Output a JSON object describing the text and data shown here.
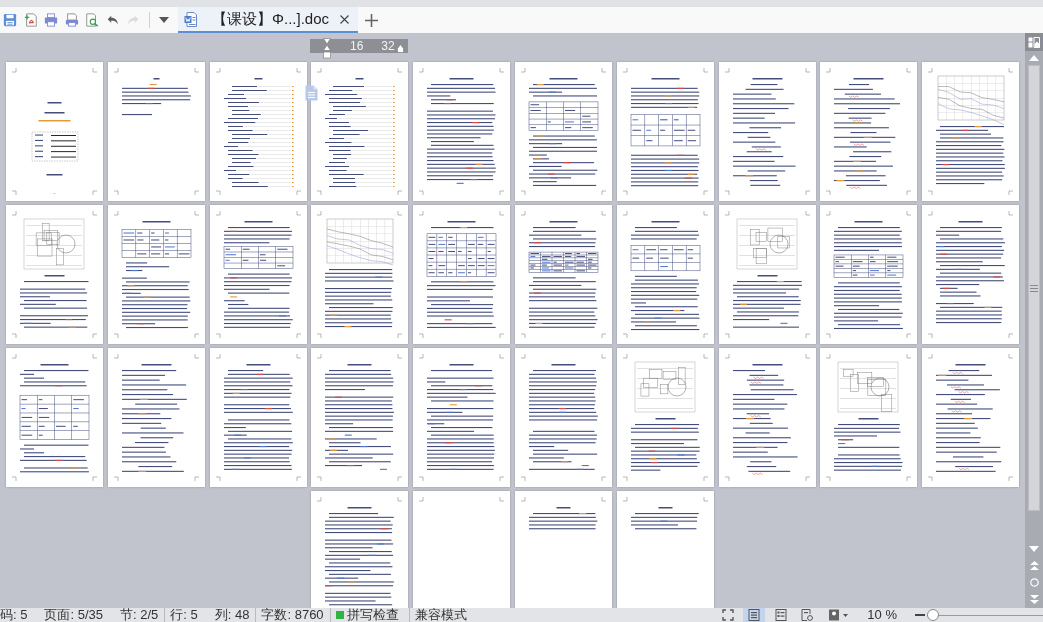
{
  "quick_access": [
    {
      "disabled": false
    },
    {
      "disabled": false
    },
    {
      "disabled": false
    },
    {
      "disabled": false
    },
    {
      "disabled": false
    },
    {
      "disabled": false
    },
    {
      "disabled": true
    }
  ],
  "tabs": [
    {
      "title": "【课设】Φ...].doc",
      "selected": true
    }
  ],
  "ruler": {
    "labels": [
      "16",
      "32"
    ]
  },
  "pages": [
    {
      "kind": "cover"
    },
    {
      "kind": "abstract"
    },
    {
      "kind": "toc"
    },
    {
      "kind": "toc"
    },
    {
      "kind": "text"
    },
    {
      "kind": "table"
    },
    {
      "kind": "table"
    },
    {
      "kind": "formula"
    },
    {
      "kind": "formula"
    },
    {
      "kind": "chart"
    },
    {
      "kind": "figure"
    },
    {
      "kind": "table"
    },
    {
      "kind": "table"
    },
    {
      "kind": "chart"
    },
    {
      "kind": "table"
    },
    {
      "kind": "table"
    },
    {
      "kind": "table"
    },
    {
      "kind": "figure"
    },
    {
      "kind": "table"
    },
    {
      "kind": "text"
    },
    {
      "kind": "table"
    },
    {
      "kind": "formula"
    },
    {
      "kind": "text"
    },
    {
      "kind": "text"
    },
    {
      "kind": "text"
    },
    {
      "kind": "text"
    },
    {
      "kind": "figure"
    },
    {
      "kind": "formula"
    },
    {
      "kind": "figure"
    },
    {
      "kind": "formula"
    },
    {
      "kind": "text"
    },
    {
      "kind": "blank"
    },
    {
      "kind": "short"
    },
    {
      "kind": "short"
    }
  ],
  "status_bar": {
    "groups": [
      [
        "码: 5",
        "页面: 5/35",
        "节: 2/5"
      ],
      [
        "行: 5",
        "列: 48"
      ],
      [
        "字数: 8760"
      ]
    ],
    "spell_check": {
      "label": "拼写检查",
      "on": true
    },
    "mode": "兼容模式",
    "view_buttons": [
      {
        "selected": false
      },
      {
        "selected": true
      },
      {
        "selected": false
      },
      {
        "selected": false
      },
      {
        "selected": false
      }
    ],
    "zoom": {
      "label": "10 %",
      "level": 0
    }
  }
}
